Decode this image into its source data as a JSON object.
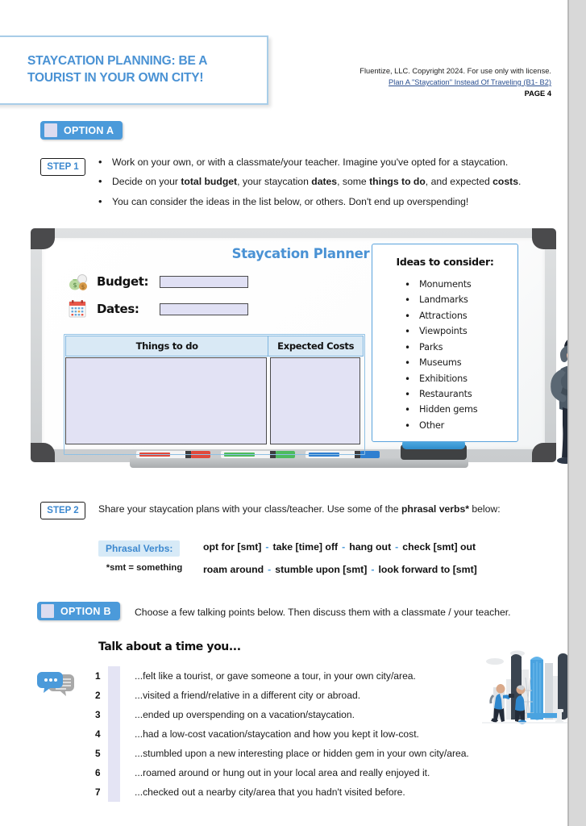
{
  "header": {
    "title": "STAYCATION PLANNING: BE A TOURIST IN YOUR OWN CITY!",
    "copyright": "Fluentize, LLC. Copyright 2024. For use only with license.",
    "lesson_link": "Plan A \"Staycation\" Instead Of Traveling (B1- B2)",
    "page_number": "PAGE 4"
  },
  "option_a": {
    "badge": "OPTION A",
    "step_label": "STEP 1",
    "bullets": [
      "Work on your own, or with a classmate/your teacher. Imagine you've opted for a staycation.",
      "Decide on your total budget, your staycation dates, some things to do, and expected costs.",
      "You can consider the ideas in the list below, or others. Don't end up overspending!"
    ]
  },
  "planner": {
    "title": "Staycation Planner",
    "budget_label": "Budget:",
    "budget_value": "",
    "budget_icon": "money-bag-icon",
    "dates_label": "Dates:",
    "dates_value": "",
    "dates_icon": "calendar-icon",
    "table_headers": [
      "Things to do",
      "Expected Costs"
    ],
    "ideas_title": "Ideas to consider:",
    "ideas": [
      "Monuments",
      "Landmarks",
      "Attractions",
      "Viewpoints",
      "Parks",
      "Museums",
      "Exhibitions",
      "Restaurants",
      "Hidden gems",
      "Other"
    ]
  },
  "step2": {
    "step_label": "STEP 2",
    "description": "Share your staycation plans with your class/teacher. Use some of the phrasal verbs* below:",
    "pv_label": "Phrasal Verbs:",
    "pv_note": "*smt = something",
    "row1": [
      "opt for [smt]",
      "take [time] off",
      "hang out",
      "check [smt] out"
    ],
    "row2": [
      "roam around",
      "stumble upon [smt]",
      "look forward to [smt]"
    ]
  },
  "option_b": {
    "badge": "OPTION B",
    "description": "Choose a few talking points below. Then discuss them with a classmate / your teacher.",
    "talk_title": "Talk about a time you...",
    "items": [
      {
        "num": "1",
        "text": "...felt like a tourist, or gave someone a tour, in your own city/area."
      },
      {
        "num": "2",
        "text": "...visited a friend/relative in a different city or abroad."
      },
      {
        "num": "3",
        "text": "...ended up overspending on a vacation/staycation."
      },
      {
        "num": "4",
        "text": "...had a low-cost vacation/staycation and how you kept it low-cost."
      },
      {
        "num": "5",
        "text": "...stumbled upon a new interesting place or hidden gem in your own city/area."
      },
      {
        "num": "6",
        "text": "...roamed around or hung out in your local area and really enjoyed it."
      },
      {
        "num": "7",
        "text": "...checked out a nearby city/area that you hadn't visited before."
      }
    ]
  },
  "colors": {
    "accent_blue": "#4b9ada",
    "title_blue": "#4a92d4",
    "lavender": "#e2e2f4",
    "panel_blue": "#d7eaf7",
    "link_blue": "#2a4f90"
  }
}
